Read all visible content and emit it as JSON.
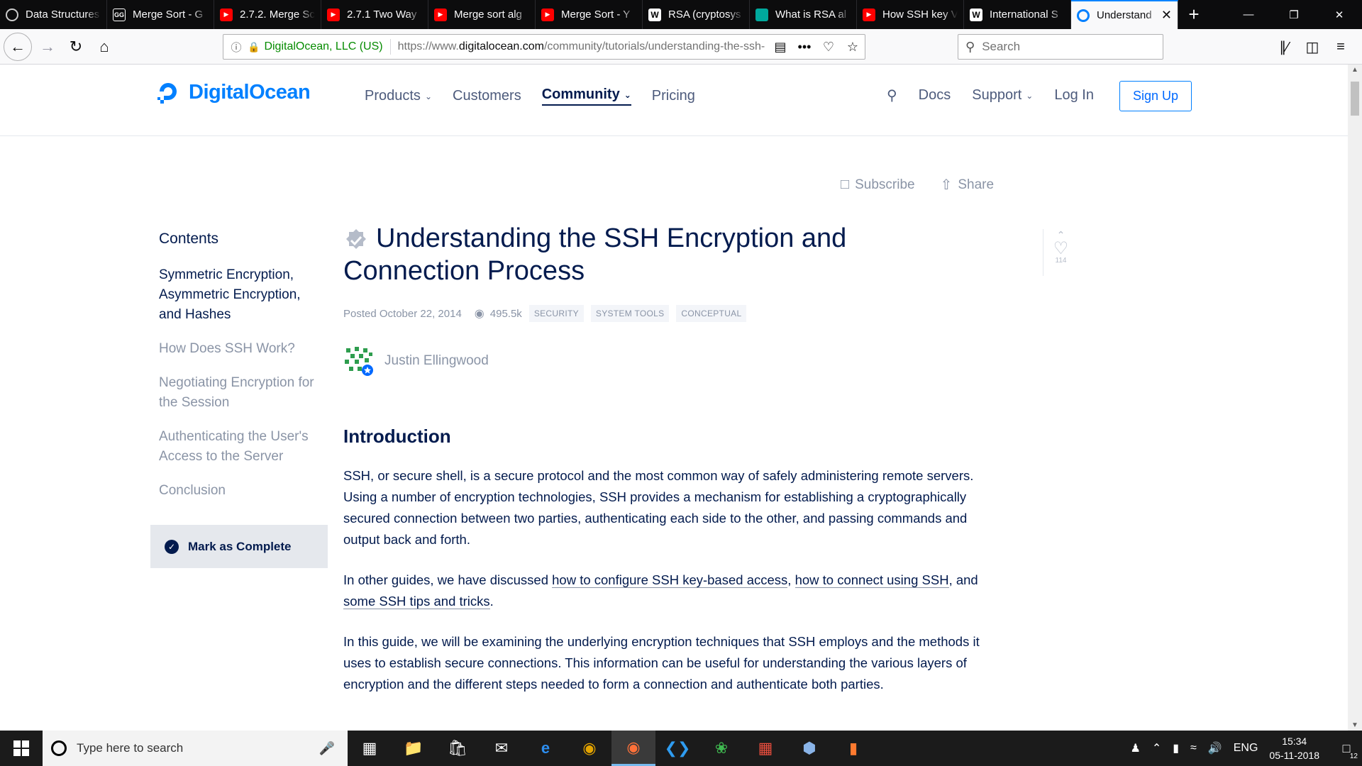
{
  "browser": {
    "tabs": [
      {
        "title": "Data Structures",
        "icon": "generic-site-icon",
        "color": "#555555"
      },
      {
        "title": "Merge Sort - G",
        "icon": "geeksforgeeks-icon",
        "color": "#2f8d46"
      },
      {
        "title": "2.7.2. Merge Sc",
        "icon": "youtube-icon",
        "color": "#ff0000"
      },
      {
        "title": "2.7.1 Two Way",
        "icon": "youtube-icon",
        "color": "#ff0000"
      },
      {
        "title": "Merge sort alg",
        "icon": "youtube-icon",
        "color": "#ff0000"
      },
      {
        "title": "Merge Sort - Y",
        "icon": "youtube-icon",
        "color": "#ff0000"
      },
      {
        "title": "RSA (cryptosys",
        "icon": "wikipedia-icon",
        "color": "#ffffff"
      },
      {
        "title": "What is RSA al",
        "icon": "generic-teal-icon",
        "color": "#00a99d"
      },
      {
        "title": "How SSH key V",
        "icon": "youtube-icon",
        "color": "#ff0000"
      },
      {
        "title": "International S",
        "icon": "wikipedia-icon",
        "color": "#ffffff"
      },
      {
        "title": "Understand",
        "icon": "digitalocean-icon",
        "color": "#0080ff",
        "active": true
      }
    ],
    "url_org": "DigitalOcean, LLC (US)",
    "url_prefix": "https://www.",
    "url_domain": "digitalocean.com",
    "url_path": "/community/tutorials/understanding-the-ssh-",
    "search_placeholder": "Search"
  },
  "site": {
    "logo_text": "DigitalOcean",
    "nav": [
      "Products",
      "Customers",
      "Community",
      "Pricing"
    ],
    "right_nav": [
      "Docs",
      "Support",
      "Log In"
    ],
    "signup": "Sign Up",
    "subscribe": "Subscribe",
    "share": "Share"
  },
  "toc": {
    "heading": "Contents",
    "items": [
      "Symmetric Encryption, Asymmetric Encryption, and Hashes",
      "How Does SSH Work?",
      "Negotiating Encryption for the Session",
      "Authenticating the User's Access to the Server",
      "Conclusion"
    ],
    "mark_complete": "Mark as Complete"
  },
  "article": {
    "title": "Understanding the SSH Encryption and Connection Process",
    "posted": "Posted",
    "date": "October 22, 2014",
    "views": "495.5k",
    "tags": [
      "SECURITY",
      "SYSTEM TOOLS",
      "CONCEPTUAL"
    ],
    "author": "Justin Ellingwood",
    "likes": "114",
    "intro_heading": "Introduction",
    "p1": "SSH, or secure shell, is a secure protocol and the most common way of safely administering remote servers. Using a number of encryption technologies, SSH provides a mechanism for establishing a cryptographically secured connection between two parties, authenticating each side to the other, and passing commands and output back and forth.",
    "p2_a": "In other guides, we have discussed ",
    "p2_link1": "how to configure SSH key-based access",
    "p2_b": ", ",
    "p2_link2": "how to connect using SSH",
    "p2_c": ", and ",
    "p2_link3": "some SSH tips and tricks",
    "p2_d": ".",
    "p3": "In this guide, we will be examining the underlying encryption techniques that SSH employs and the methods it uses to establish secure connections. This information can be useful for understanding the various layers of encryption and the different steps needed to form a connection and authenticate both parties."
  },
  "taskbar": {
    "search_placeholder": "Type here to search",
    "lang": "ENG",
    "time": "15:34",
    "date": "05-11-2018",
    "notif_count": "12"
  }
}
